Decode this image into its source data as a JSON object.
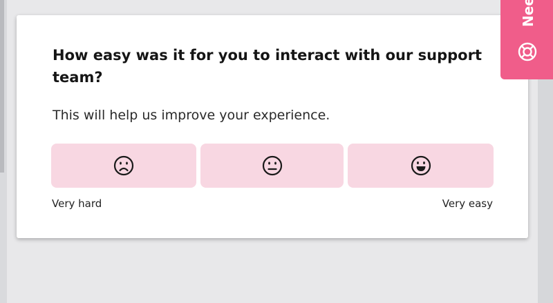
{
  "survey": {
    "question": "How easy was it for you to interact with our support team?",
    "subtitle": "This will help us improve your experience.",
    "options": [
      {
        "icon": "frown-face-icon"
      },
      {
        "icon": "neutral-face-icon"
      },
      {
        "icon": "smile-face-icon"
      }
    ],
    "scale_min_label": "Very hard",
    "scale_max_label": "Very easy"
  },
  "help_tab": {
    "label": "Nee",
    "icon": "lifebuoy-icon"
  },
  "colors": {
    "option_bg": "#f8d7e2",
    "accent": "#f05d8a",
    "card_bg": "#ffffff",
    "page_bg": "#e8e8ea"
  }
}
